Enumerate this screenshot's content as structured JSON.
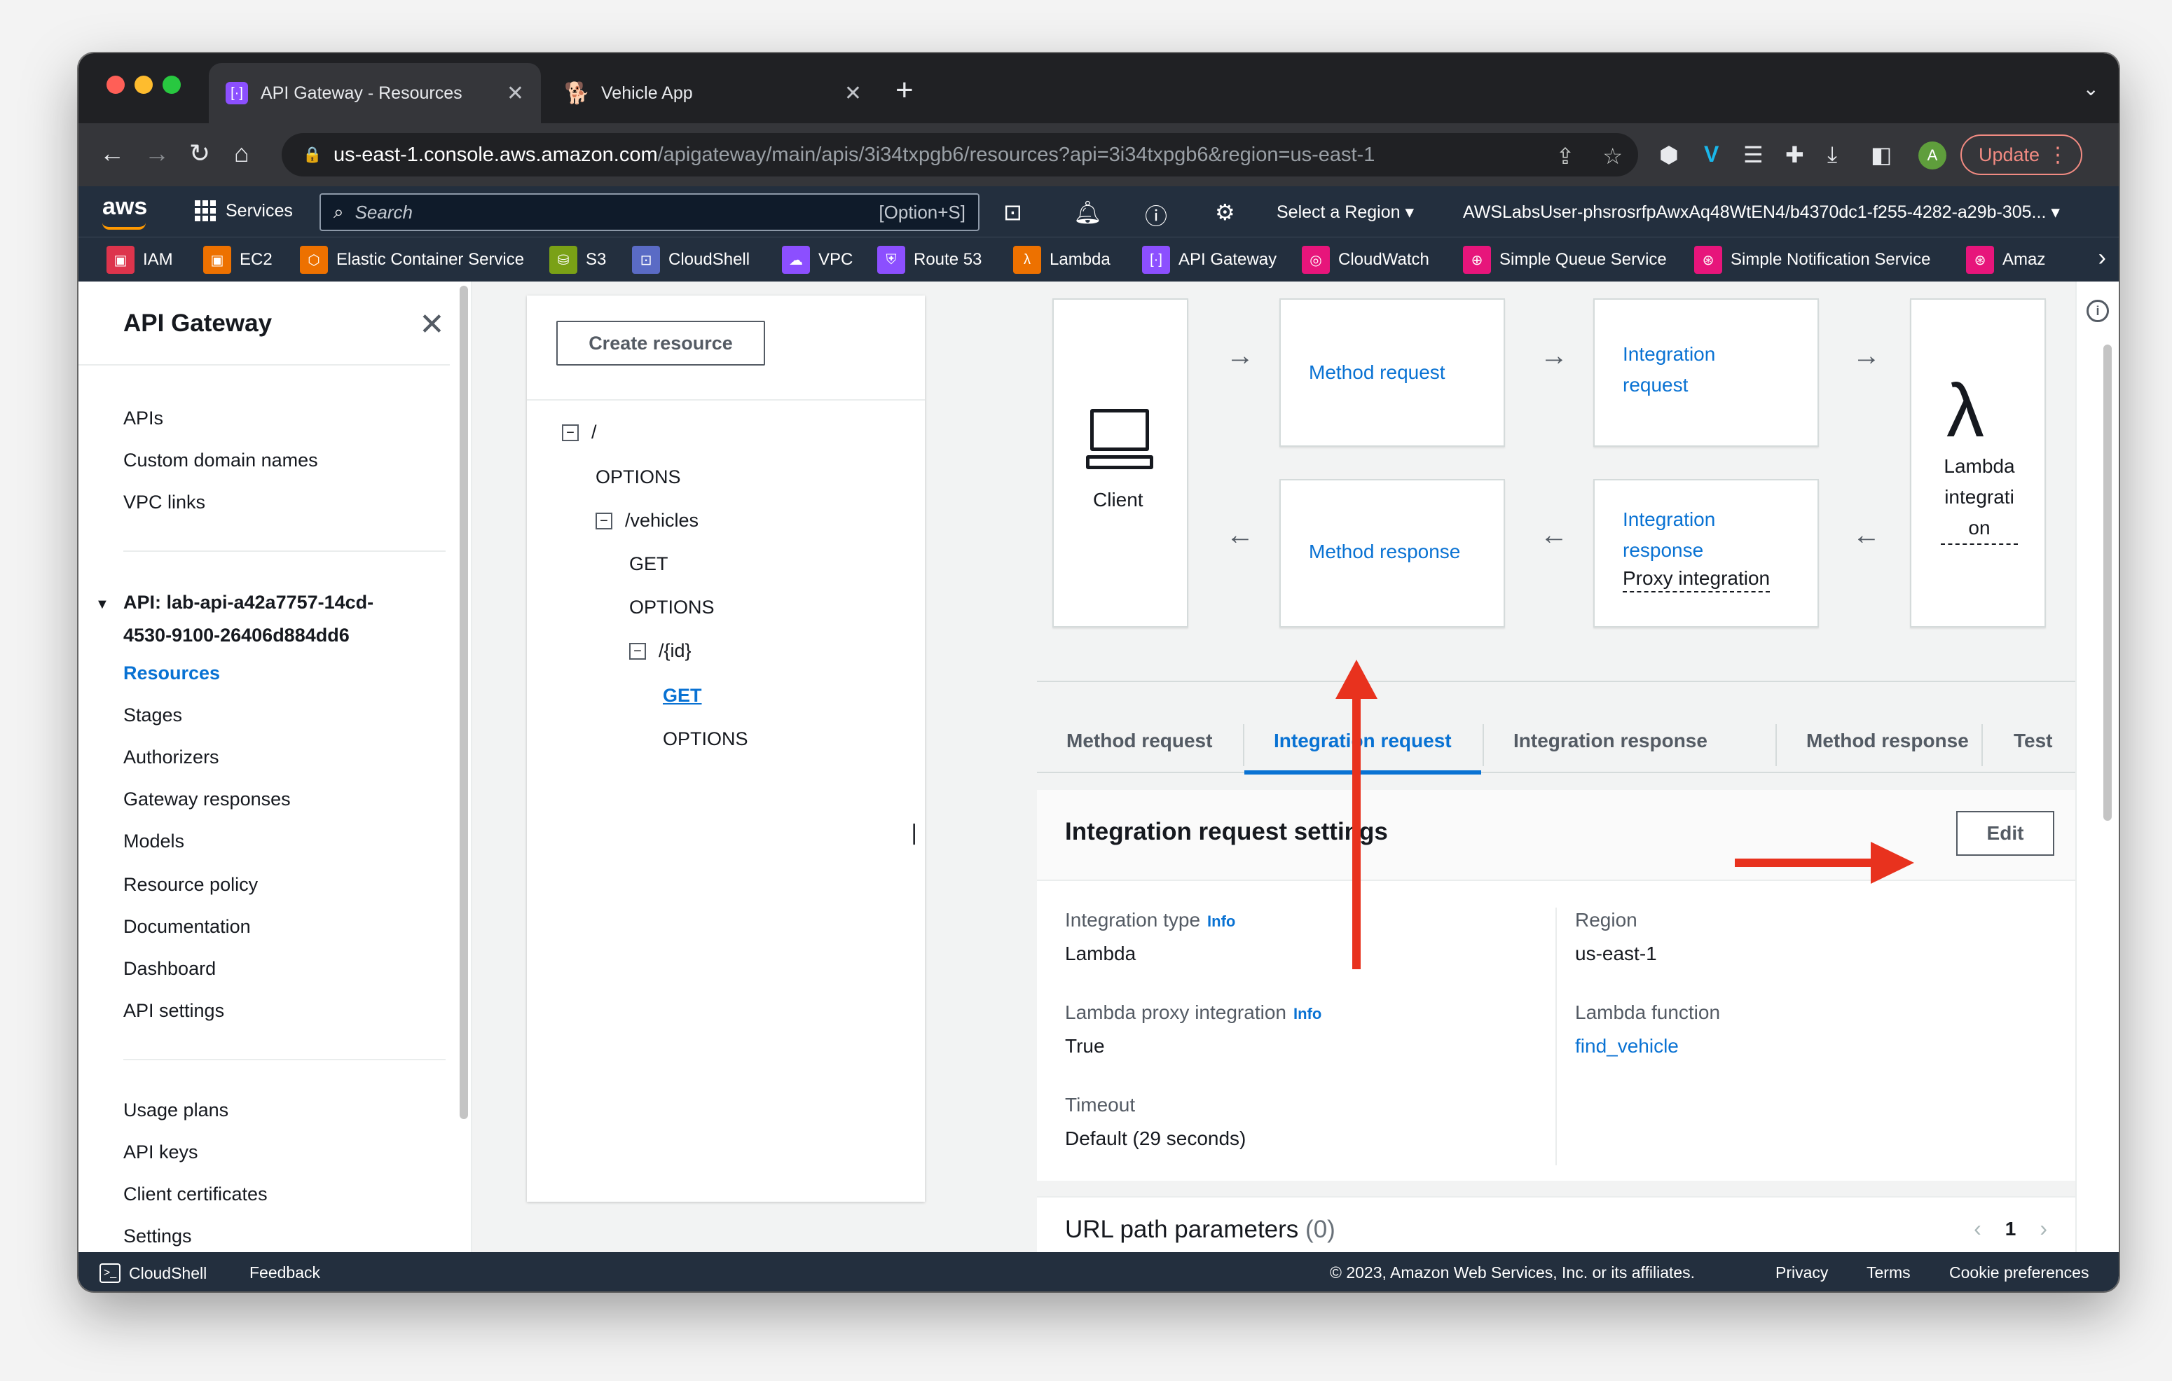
{
  "browser": {
    "tabs": [
      {
        "title": "API Gateway - Resources",
        "active": true
      },
      {
        "title": "Vehicle App",
        "active": false
      }
    ],
    "url_host": "us-east-1.console.aws.amazon.com",
    "url_path": "/apigateway/main/apis/3i34txpgb6/resources?api=3i34txpgb6&region=us-east-1",
    "profile_initial": "A",
    "update_label": "Update"
  },
  "aws_header": {
    "logo": "aws",
    "services_label": "Services",
    "search_placeholder": "Search",
    "search_hint": "[Option+S]",
    "region_label": "Select a Region",
    "account_label": "AWSLabsUser-phsrosrfpAwxAq48WtEN4/b4370dc1-f255-4282-a29b-305..."
  },
  "favorites": [
    {
      "label": "IAM",
      "color": "#dd344c"
    },
    {
      "label": "EC2",
      "color": "#ed7100"
    },
    {
      "label": "Elastic Container Service",
      "color": "#ed7100"
    },
    {
      "label": "S3",
      "color": "#7aa116"
    },
    {
      "label": "CloudShell",
      "color": "#5a6bc5"
    },
    {
      "label": "VPC",
      "color": "#8c4fff"
    },
    {
      "label": "Route 53",
      "color": "#8c4fff"
    },
    {
      "label": "Lambda",
      "color": "#ed7100"
    },
    {
      "label": "API Gateway",
      "color": "#8c4fff"
    },
    {
      "label": "CloudWatch",
      "color": "#e7157b"
    },
    {
      "label": "Simple Queue Service",
      "color": "#e7157b"
    },
    {
      "label": "Simple Notification Service",
      "color": "#e7157b"
    },
    {
      "label": "Amaz",
      "color": "#e7157b"
    }
  ],
  "sidenav": {
    "title": "API Gateway",
    "top_links": [
      "APIs",
      "Custom domain names",
      "VPC links"
    ],
    "api_group_line1": "API: lab-api-a42a7757-14cd-",
    "api_group_line2": "4530-9100-26406d884dd6",
    "api_links": [
      "Resources",
      "Stages",
      "Authorizers",
      "Gateway responses",
      "Models",
      "Resource policy",
      "Documentation",
      "Dashboard",
      "API settings"
    ],
    "bottom_links": [
      "Usage plans",
      "API keys",
      "Client certificates",
      "Settings"
    ]
  },
  "resources": {
    "create_button": "Create resource",
    "tree": [
      {
        "label": "/"
      },
      {
        "label": "OPTIONS"
      },
      {
        "label": "/vehicles"
      },
      {
        "label": "GET"
      },
      {
        "label": "OPTIONS"
      },
      {
        "label": "/{id}"
      },
      {
        "label": "GET"
      },
      {
        "label": "OPTIONS"
      }
    ]
  },
  "flow": {
    "client": "Client",
    "method_request": "Method request",
    "integration_request_1": "Integration",
    "integration_request_2": "request",
    "method_response": "Method response",
    "integration_response_1": "Integration",
    "integration_response_2": "response",
    "proxy_integration": "Proxy integration",
    "lambda_1": "Lambda",
    "lambda_2": "integrati",
    "lambda_3": "on"
  },
  "tabs": [
    "Method request",
    "Integration request",
    "Integration response",
    "Method response",
    "Test"
  ],
  "settings": {
    "title": "Integration request settings",
    "edit_button": "Edit",
    "info": "Info",
    "integration_type_label": "Integration type",
    "integration_type_value": "Lambda",
    "proxy_label": "Lambda proxy integration",
    "proxy_value": "True",
    "timeout_label": "Timeout",
    "timeout_value": "Default (29 seconds)",
    "region_label": "Region",
    "region_value": "us-east-1",
    "function_label": "Lambda function",
    "function_value": "find_vehicle"
  },
  "url_params": {
    "title": "URL path parameters",
    "count": "(0)",
    "page": "1"
  },
  "footer": {
    "cloudshell": "CloudShell",
    "feedback": "Feedback",
    "copyright": "© 2023, Amazon Web Services, Inc. or its affiliates.",
    "privacy": "Privacy",
    "terms": "Terms",
    "cookies": "Cookie preferences"
  },
  "colors": {
    "aws_nav": "#232f3e",
    "link_blue": "#0972d3",
    "annotation_red": "#e8321e"
  }
}
